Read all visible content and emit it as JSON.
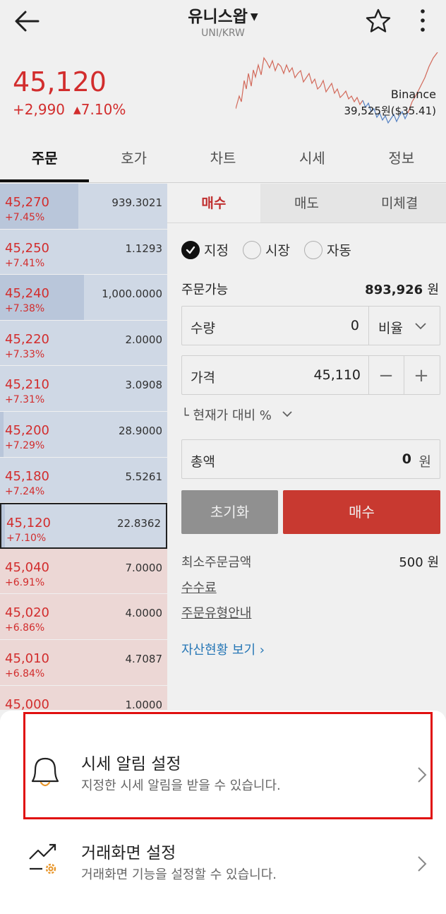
{
  "header": {
    "title": "유니스왑",
    "subtitle": "UNI/KRW"
  },
  "ticker": {
    "price": "45,120",
    "change_amount": "+2,990",
    "change_arrow": "▲",
    "change_pct": "7.10%",
    "exchange_name": "Binance",
    "exchange_price": "39,525원($35.41)",
    "up_color": "#e03030"
  },
  "tabs": [
    "주문",
    "호가",
    "차트",
    "시세",
    "정보"
  ],
  "orderbook": [
    {
      "price": "45,270",
      "rate": "+7.45%",
      "qty": "939.3021",
      "side": "ask",
      "fill": 0.47
    },
    {
      "price": "45,250",
      "rate": "+7.41%",
      "qty": "1.1293",
      "side": "ask",
      "fill": 0.0
    },
    {
      "price": "45,240",
      "rate": "+7.38%",
      "qty": "1,000.0000",
      "side": "ask",
      "fill": 0.5
    },
    {
      "price": "45,220",
      "rate": "+7.33%",
      "qty": "2.0000",
      "side": "ask",
      "fill": 0.0
    },
    {
      "price": "45,210",
      "rate": "+7.31%",
      "qty": "3.0908",
      "side": "ask",
      "fill": 0.0
    },
    {
      "price": "45,200",
      "rate": "+7.29%",
      "qty": "28.9000",
      "side": "ask",
      "fill": 0.02
    },
    {
      "price": "45,180",
      "rate": "+7.24%",
      "qty": "5.5261",
      "side": "ask",
      "fill": 0.0
    },
    {
      "price": "45,120",
      "rate": "+7.10%",
      "qty": "22.8362",
      "side": "ask",
      "fill": 0.02,
      "current": true
    },
    {
      "price": "45,040",
      "rate": "+6.91%",
      "qty": "7.0000",
      "side": "bid",
      "fill": 0.0
    },
    {
      "price": "45,020",
      "rate": "+6.86%",
      "qty": "4.0000",
      "side": "bid",
      "fill": 0.0
    },
    {
      "price": "45,010",
      "rate": "+6.84%",
      "qty": "4.7087",
      "side": "bid",
      "fill": 0.0
    },
    {
      "price": "45,000",
      "rate": "",
      "qty": "1.0000",
      "side": "bid",
      "fill": 0.0
    }
  ],
  "order": {
    "tabs": [
      "매수",
      "매도",
      "미체결"
    ],
    "types": [
      "지정",
      "시장",
      "자동"
    ],
    "available_label": "주문가능",
    "available_value": "893,926",
    "won": "원",
    "qty_label": "수량",
    "qty_value": "0",
    "ratio_label": "비율",
    "price_label": "가격",
    "price_value": "45,110",
    "minus": "−",
    "plus": "+",
    "compare_label": "└ 현재가 대비 %",
    "total_label": "총액",
    "total_value": "0",
    "reset_label": "초기화",
    "buy_label": "매수",
    "min_label": "최소주문금액",
    "min_value": "500 원",
    "fee_link": "수수료",
    "guide_link": "주문유형안내",
    "assets_link": "자산현황 보기 ›"
  },
  "sheet": {
    "items": [
      {
        "title": "시세 알림 설정",
        "desc": "지정한 시세 알림을 받을 수 있습니다.",
        "icon": "bell-icon"
      },
      {
        "title": "거래화면 설정",
        "desc": "거래화면 기능을 설정할 수 있습니다.",
        "icon": "trend-gear-icon"
      }
    ]
  }
}
